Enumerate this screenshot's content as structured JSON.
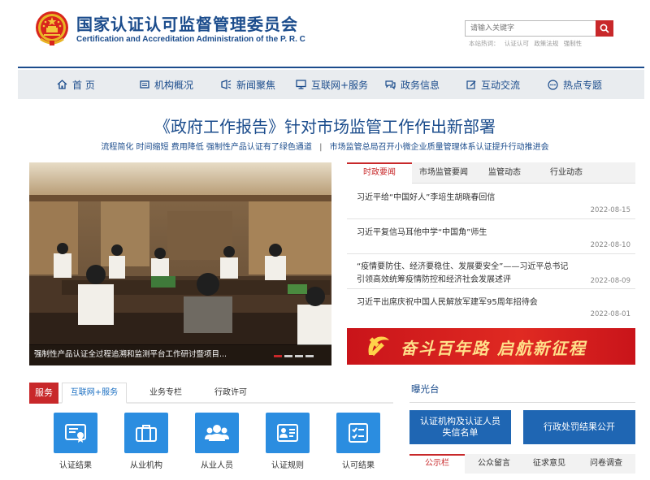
{
  "header": {
    "title_cn": "国家认证认可监督管理委员会",
    "title_en": "Certification and Accreditation Administration of the P. R. C",
    "search_placeholder": "请输入关键字",
    "hot_label": "本站热词：",
    "hot_words": [
      "认证认可",
      "政策法规",
      "强制性"
    ]
  },
  "nav": [
    {
      "label": "首 页",
      "icon": "home-icon"
    },
    {
      "label": "机构概况",
      "icon": "building-icon"
    },
    {
      "label": "新闻聚焦",
      "icon": "news-icon"
    },
    {
      "label": "互联网+服务",
      "icon": "monitor-icon"
    },
    {
      "label": "政务信息",
      "icon": "chat-icon"
    },
    {
      "label": "互动交流",
      "icon": "edit-icon"
    },
    {
      "label": "热点专题",
      "icon": "more-icon"
    }
  ],
  "headline": {
    "title": "《政府工作报告》针对市场监管工作作出新部署",
    "sub_left": "流程简化 时间缩短 费用降低 强制性产品认证有了绿色通道",
    "sub_sep": "|",
    "sub_right": "市场监管总局召开小微企业质量管理体系认证提升行动推进会"
  },
  "photo": {
    "caption": "强制性产品认证全过程追溯和监测平台工作研讨暨项目..."
  },
  "news": {
    "tabs": [
      "时政要闻",
      "市场监管要闻",
      "监管动态",
      "行业动态"
    ],
    "items": [
      {
        "title": "习近平给“中国好人”李培生胡晓春回信",
        "date": "2022-08-15"
      },
      {
        "title": "习近平复信马耳他中学“中国角”师生",
        "date": "2022-08-10"
      },
      {
        "title": "“疫情要防住、经济要稳住、发展要安全”——习近平总书记",
        "title2": "引领高效统筹疫情防控和经济社会发展述评",
        "date": "2022-08-09"
      },
      {
        "title": "习近平出席庆祝中国人民解放军建军95周年招待会",
        "date": "2022-08-01"
      }
    ]
  },
  "banner": {
    "text": "奋斗百年路 启航新征程"
  },
  "services": {
    "label": "服务",
    "tabs": [
      "互联网+服务",
      "业务专栏",
      "行政许可"
    ],
    "items": [
      {
        "label": "认证结果",
        "icon": "certificate-icon"
      },
      {
        "label": "从业机构",
        "icon": "briefcase-icon"
      },
      {
        "label": "从业人员",
        "icon": "people-icon"
      },
      {
        "label": "认证规则",
        "icon": "id-card-icon"
      },
      {
        "label": "认可结果",
        "icon": "checklist-icon"
      }
    ]
  },
  "exposure": {
    "title": "曝光台",
    "btn1_line1": "认证机构及认证人员",
    "btn1_line2": "失信名单",
    "btn2": "行政处罚结果公开",
    "tabs": [
      "公示栏",
      "公众留言",
      "征求意见",
      "问卷调查"
    ]
  },
  "colors": {
    "brand_blue": "#1b4c8c",
    "accent_red": "#c8282a",
    "service_blue": "#2b8de0"
  }
}
